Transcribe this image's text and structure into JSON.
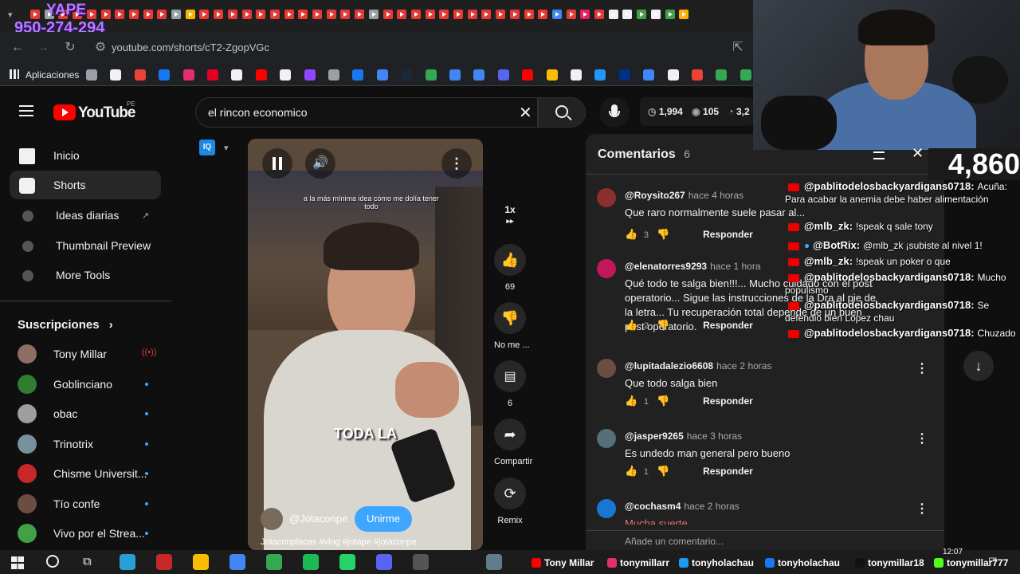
{
  "overlay": {
    "yape_title": "YAPE",
    "yape_number": "950-274-294",
    "counter": "4,860"
  },
  "browser": {
    "url": "youtube.com/shorts/cT2-ZgopVGc",
    "bookmarks_label": "Aplicaciones",
    "tab_count_red": 17
  },
  "youtube": {
    "logo_text": "YouTube",
    "logo_region": "PE",
    "search_value": "el rincon economico",
    "stats": {
      "likes": "1,994",
      "views": "105",
      "extra": "3,2"
    },
    "sidebar": {
      "items": [
        {
          "label": "Inicio",
          "icon": "home-icon"
        },
        {
          "label": "Shorts",
          "icon": "shorts-icon"
        },
        {
          "label": "Ideas diarias",
          "icon": "ideas-icon"
        },
        {
          "label": "Thumbnail Preview",
          "icon": "thumbnail-icon"
        },
        {
          "label": "More Tools",
          "icon": "tools-icon"
        }
      ],
      "subs_title": "Suscripciones",
      "subs": [
        {
          "name": "Tony Millar",
          "live": true
        },
        {
          "name": "Goblinciano",
          "live": false
        },
        {
          "name": "obac",
          "live": false
        },
        {
          "name": "Trinotrix",
          "live": false
        },
        {
          "name": "Chisme Universit...",
          "live": false
        },
        {
          "name": "Tío confe",
          "live": false
        },
        {
          "name": "Vivo por el Strea...",
          "live": false
        }
      ]
    },
    "short": {
      "caption_top": "a la más mínima idea cómo me dolía tener todo",
      "caption_center": "TODA LA",
      "channel": "@Jotaconpe",
      "join_label": "Unirme",
      "hashtags": "Jotaconplacas #vlog #jotape #jotaconpe"
    },
    "actions": {
      "speed": "1x",
      "likes": "69",
      "dislike_label": "No me ...",
      "comments": "6",
      "share_label": "Compartir",
      "remix_label": "Remix"
    },
    "comments": {
      "title": "Comentarios",
      "count": "6",
      "add_placeholder": "Añade un comentario...",
      "reply_label": "Responder",
      "items": [
        {
          "user": "@Roysito267",
          "time": "hace 4 horas",
          "text": "Que raro normalmente suele pasar al...",
          "likes": "3",
          "color": "#8b2e2e"
        },
        {
          "user": "@elenatorres9293",
          "time": "hace 1 hora",
          "text": "Qué todo te salga bien!!!... Mucho cuidado con el post operatorio... Sigue las instrucciones de la Dra al pie de la letra... Tu recuperación total depende de un buen post operatorio.",
          "likes": "2",
          "color": "#c2185b"
        },
        {
          "user": "@lupitadalezio6608",
          "time": "hace 2 horas",
          "text": "Que todo salga bien",
          "likes": "1",
          "color": "#6d4c41"
        },
        {
          "user": "@jasper9265",
          "time": "hace 3 horas",
          "text": "Es undedo man general pero bueno",
          "likes": "1",
          "color": "#546e7a"
        },
        {
          "user": "@cochasm4",
          "time": "hace 2 horas",
          "text": "Mucha suerte",
          "likes": "",
          "color": "#1976d2"
        }
      ]
    }
  },
  "chat": [
    {
      "user": "@pablitodelosbackyardigans0718:",
      "msg": "Acuña: Para acabar la anemia debe haber alimentación"
    },
    {
      "user": "@mlb_zk:",
      "msg": "!speak q sale tony"
    },
    {
      "user": "@BotRix:",
      "msg": "@mlb_zk ¡subiste al nivel 1!"
    },
    {
      "user": "@mlb_zk:",
      "msg": "!speak un poker o que"
    },
    {
      "user": "@pablitodelosbackyardigans0718:",
      "msg": "Mucho populismo"
    },
    {
      "user": "@pablitodelosbackyardigans0718:",
      "msg": "Se defendio bien Lopez chau"
    },
    {
      "user": "@pablitodelosbackyardigans0718:",
      "msg": "Chuzado"
    }
  ],
  "taskbar": {
    "time": "12:07",
    "socials": [
      {
        "name": "Tony Millar",
        "icon": "youtube-icon"
      },
      {
        "name": "tonymillarr",
        "icon": "instagram-icon"
      },
      {
        "name": "tonyholachau",
        "icon": "twitter-icon"
      },
      {
        "name": "tonyholachau",
        "icon": "facebook-icon"
      },
      {
        "name": "tonymillar18",
        "icon": "tiktok-icon"
      },
      {
        "name": "tonymillar777",
        "icon": "kick-icon"
      }
    ]
  },
  "colors": {
    "accent": "#3ea6ff",
    "yt_red": "#ff0000",
    "join": "#3ea6ff",
    "yape": "#7b2fbe"
  }
}
